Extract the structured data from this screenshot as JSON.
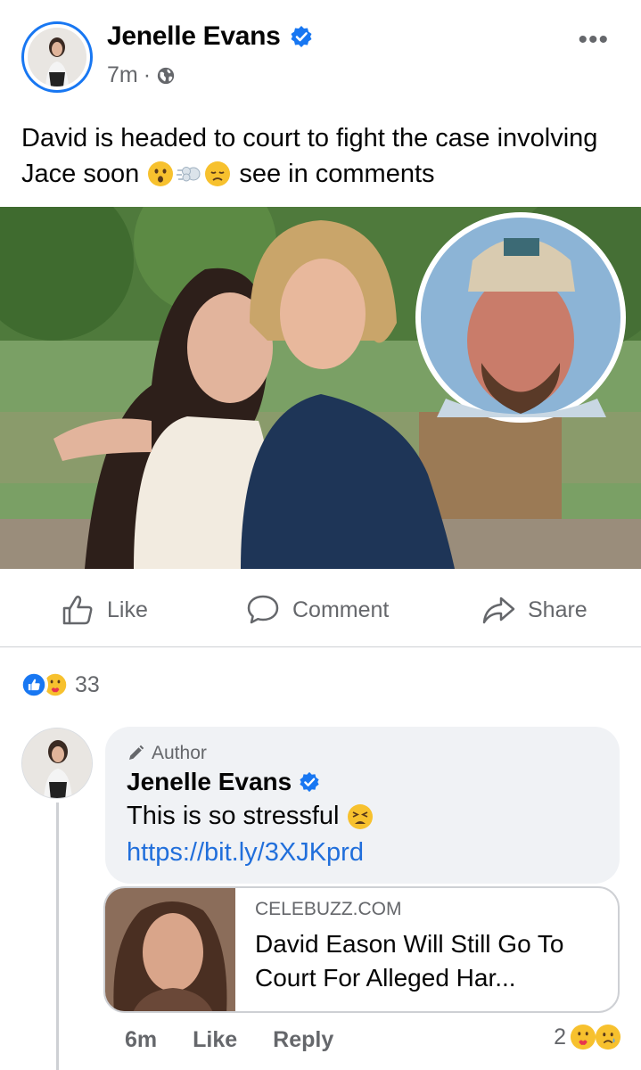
{
  "post": {
    "author": "Jenelle Evans",
    "time": "7m",
    "separator": "·",
    "more": "•••",
    "caption_part1": "David is headed to court to fight the case involving Jace soon",
    "caption_part2": "see in comments"
  },
  "actions": {
    "like": "Like",
    "comment": "Comment",
    "share": "Share"
  },
  "reactions": {
    "count": "33"
  },
  "comment": {
    "author_label": "Author",
    "author": "Jenelle Evans",
    "text": "This is so stressful",
    "link": "https://bit.ly/3XJKprd",
    "time": "6m",
    "like": "Like",
    "reply": "Reply",
    "reaction_count": "2"
  },
  "link_preview": {
    "domain": "CELEBUZZ.COM",
    "title": "David Eason Will Still Go To Court For Alleged Har..."
  },
  "colors": {
    "facebook_blue": "#1877f2",
    "link_blue": "#216fdb",
    "secondary_text": "#65676b",
    "bubble_bg": "#f0f2f5"
  }
}
